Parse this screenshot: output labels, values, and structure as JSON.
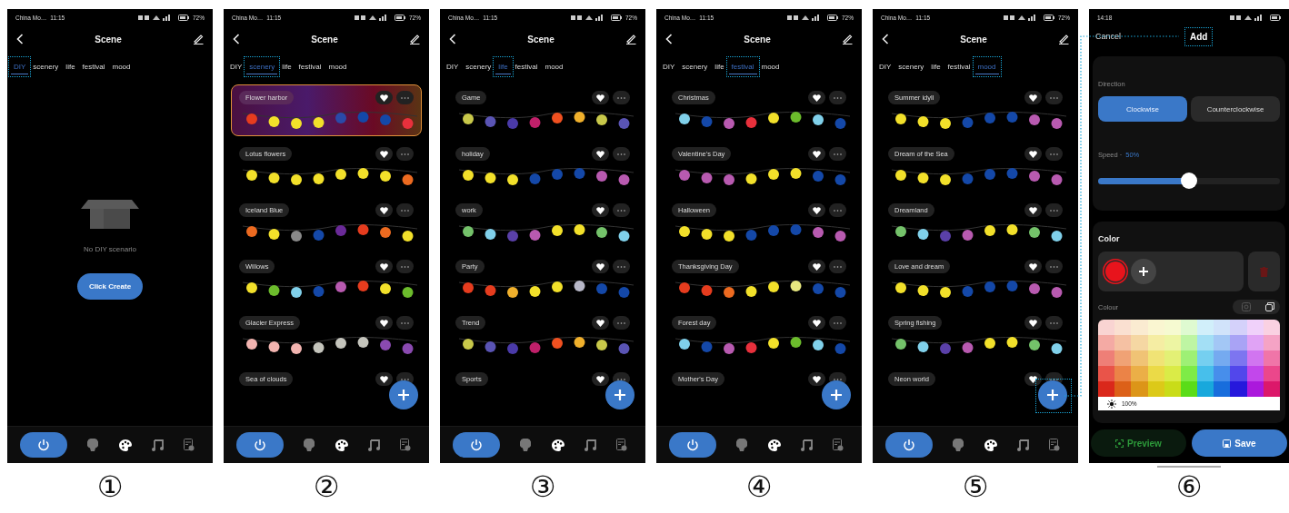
{
  "screens": [
    {
      "kind": "scene_list",
      "caption": "①",
      "status": {
        "carrier": "China Mo…",
        "time": "11:15",
        "battery": "72%"
      },
      "title": "Scene",
      "tabs": [
        {
          "label": "DIY",
          "selected": true
        },
        {
          "label": "scenery",
          "selected": false
        },
        {
          "label": "life",
          "selected": false
        },
        {
          "label": "festival",
          "selected": false
        },
        {
          "label": "mood",
          "selected": false
        }
      ],
      "empty": {
        "message": "No DIY scenario",
        "button": "Click Create"
      },
      "nav": [
        {
          "kind": "power",
          "selected": true
        },
        {
          "kind": "bulb",
          "selected": false
        },
        {
          "kind": "palette",
          "selected": true
        },
        {
          "kind": "music",
          "selected": false
        },
        {
          "kind": "schedule",
          "selected": false
        }
      ]
    },
    {
      "kind": "scene_list",
      "caption": "②",
      "status": {
        "carrier": "China Mo…",
        "time": "11:15",
        "battery": "72%"
      },
      "title": "Scene",
      "tabs": [
        {
          "label": "DIY",
          "selected": false
        },
        {
          "label": "scenery",
          "selected": true
        },
        {
          "label": "life",
          "selected": false
        },
        {
          "label": "festival",
          "selected": false
        },
        {
          "label": "mood",
          "selected": false
        }
      ],
      "scenes": [
        {
          "name": "Flower harbor",
          "selected": true,
          "lights": [
            {
              "color": "#e63c1e"
            },
            {
              "color": "#f2e02a"
            },
            {
              "color": "#f2e02a"
            },
            {
              "color": "#f2e02a"
            },
            {
              "color": "#2a4aa8"
            },
            {
              "color": "#1448a8"
            },
            {
              "color": "#1448a8"
            },
            {
              "color": "#e8303c"
            }
          ]
        },
        {
          "name": "Lotus flowers",
          "selected": false,
          "lights": [
            {
              "color": "#f2e02a"
            },
            {
              "color": "#f2e02a"
            },
            {
              "color": "#f2e02a"
            },
            {
              "color": "#f2e02a"
            },
            {
              "color": "#f2e02a"
            },
            {
              "color": "#f2e02a"
            },
            {
              "color": "#f2e02a"
            },
            {
              "color": "#ec6a20"
            }
          ]
        },
        {
          "name": "Iceland Blue",
          "selected": false,
          "lights": [
            {
              "color": "#ec6a20"
            },
            {
              "color": "#f2e02a"
            },
            {
              "color": "#8a8a8a"
            },
            {
              "color": "#1448a8"
            },
            {
              "color": "#6a2a98"
            },
            {
              "color": "#e63c1e"
            },
            {
              "color": "#ec6a20"
            },
            {
              "color": "#f2e02a"
            }
          ]
        },
        {
          "name": "Willows",
          "selected": false,
          "lights": [
            {
              "color": "#f2e02a"
            },
            {
              "color": "#6cbc2c"
            },
            {
              "color": "#80d0ea"
            },
            {
              "color": "#1448a8"
            },
            {
              "color": "#b85ab0"
            },
            {
              "color": "#e63c1e"
            },
            {
              "color": "#f2e02a"
            },
            {
              "color": "#6cbc2c"
            }
          ]
        },
        {
          "name": "Glacier Express",
          "selected": false,
          "lights": [
            {
              "color": "#f2b4b0"
            },
            {
              "color": "#f2b4b0"
            },
            {
              "color": "#f2b4b0"
            },
            {
              "color": "#c4c4bc"
            },
            {
              "color": "#c4c4bc"
            },
            {
              "color": "#c4c4bc"
            },
            {
              "color": "#8a4ab0"
            },
            {
              "color": "#8a4ab0"
            }
          ]
        },
        {
          "name": "Sea of clouds",
          "selected": false
        }
      ],
      "fab": {
        "highlighted": false
      },
      "nav": [
        {
          "kind": "power",
          "selected": true
        },
        {
          "kind": "bulb",
          "selected": false
        },
        {
          "kind": "palette",
          "selected": true
        },
        {
          "kind": "music",
          "selected": false
        },
        {
          "kind": "schedule",
          "selected": false
        }
      ]
    },
    {
      "kind": "scene_list",
      "caption": "③",
      "status": {
        "carrier": "China Mo…",
        "time": "11:15",
        "battery": "72%"
      },
      "title": "Scene",
      "tabs": [
        {
          "label": "DIY",
          "selected": false
        },
        {
          "label": "scenery",
          "selected": false
        },
        {
          "label": "life",
          "selected": true
        },
        {
          "label": "festival",
          "selected": false
        },
        {
          "label": "mood",
          "selected": false
        }
      ],
      "scenes": [
        {
          "name": "Game",
          "selected": false,
          "lights": [
            {
              "color": "#c8c84a"
            },
            {
              "color": "#5a54b4"
            },
            {
              "color": "#4a3aa8"
            },
            {
              "color": "#c0206a"
            },
            {
              "color": "#f05020"
            },
            {
              "color": "#f0b02c"
            },
            {
              "color": "#c8c84a"
            },
            {
              "color": "#5a54b4"
            }
          ]
        },
        {
          "name": "holiday",
          "selected": false,
          "lights": [
            {
              "color": "#f2e02a"
            },
            {
              "color": "#f2e02a"
            },
            {
              "color": "#f2e02a"
            },
            {
              "color": "#1448a8"
            },
            {
              "color": "#1448a8"
            },
            {
              "color": "#1448a8"
            },
            {
              "color": "#b85ab0"
            },
            {
              "color": "#b85ab0"
            }
          ]
        },
        {
          "name": "work",
          "selected": false,
          "lights": [
            {
              "color": "#74c26a"
            },
            {
              "color": "#80d0ea"
            },
            {
              "color": "#5a40a8"
            },
            {
              "color": "#b85ab0"
            },
            {
              "color": "#f2e02a"
            },
            {
              "color": "#f2e02a"
            },
            {
              "color": "#74c26a"
            },
            {
              "color": "#80d0ea"
            }
          ]
        },
        {
          "name": "Party",
          "selected": false,
          "lights": [
            {
              "color": "#e63c1e"
            },
            {
              "color": "#e63c1e"
            },
            {
              "color": "#f0b02c"
            },
            {
              "color": "#f2e02a"
            },
            {
              "color": "#f2e02a"
            },
            {
              "color": "#b8b8c8"
            },
            {
              "color": "#1448a8"
            },
            {
              "color": "#1448a8"
            }
          ]
        },
        {
          "name": "Trend",
          "selected": false,
          "lights": [
            {
              "color": "#c8c84a"
            },
            {
              "color": "#5a54b4"
            },
            {
              "color": "#4a3aa8"
            },
            {
              "color": "#c0206a"
            },
            {
              "color": "#f05020"
            },
            {
              "color": "#f0b02c"
            },
            {
              "color": "#c8c84a"
            },
            {
              "color": "#5a54b4"
            }
          ]
        },
        {
          "name": "Sports",
          "selected": false
        }
      ],
      "fab": {
        "highlighted": false
      },
      "nav": [
        {
          "kind": "power",
          "selected": true
        },
        {
          "kind": "bulb",
          "selected": false
        },
        {
          "kind": "palette",
          "selected": true
        },
        {
          "kind": "music",
          "selected": false
        },
        {
          "kind": "schedule",
          "selected": false
        }
      ]
    },
    {
      "kind": "scene_list",
      "caption": "④",
      "status": {
        "carrier": "China Mo…",
        "time": "11:15",
        "battery": "72%"
      },
      "title": "Scene",
      "tabs": [
        {
          "label": "DIY",
          "selected": false
        },
        {
          "label": "scenery",
          "selected": false
        },
        {
          "label": "life",
          "selected": false
        },
        {
          "label": "festival",
          "selected": true
        },
        {
          "label": "mood",
          "selected": false
        }
      ],
      "scenes": [
        {
          "name": "Christmas",
          "selected": false,
          "lights": [
            {
              "color": "#80d0ea"
            },
            {
              "color": "#1448a8"
            },
            {
              "color": "#b85ab0"
            },
            {
              "color": "#e8303c"
            },
            {
              "color": "#f2e02a"
            },
            {
              "color": "#6cbc2c"
            },
            {
              "color": "#80d0ea"
            },
            {
              "color": "#1448a8"
            }
          ]
        },
        {
          "name": "Valentine's Day",
          "selected": false,
          "lights": [
            {
              "color": "#b85ab0"
            },
            {
              "color": "#b85ab0"
            },
            {
              "color": "#b85ab0"
            },
            {
              "color": "#f2e02a"
            },
            {
              "color": "#f2e02a"
            },
            {
              "color": "#f2e02a"
            },
            {
              "color": "#1448a8"
            },
            {
              "color": "#1448a8"
            }
          ]
        },
        {
          "name": "Halloween",
          "selected": false,
          "lights": [
            {
              "color": "#f2e02a"
            },
            {
              "color": "#f2e02a"
            },
            {
              "color": "#f2e02a"
            },
            {
              "color": "#1448a8"
            },
            {
              "color": "#1448a8"
            },
            {
              "color": "#1448a8"
            },
            {
              "color": "#b85ab0"
            },
            {
              "color": "#b85ab0"
            }
          ]
        },
        {
          "name": "Thanksgiving Day",
          "selected": false,
          "lights": [
            {
              "color": "#e63c1e"
            },
            {
              "color": "#e63c1e"
            },
            {
              "color": "#ec6a20"
            },
            {
              "color": "#f2e02a"
            },
            {
              "color": "#f2e02a"
            },
            {
              "color": "#e8e880"
            },
            {
              "color": "#1448a8"
            },
            {
              "color": "#1448a8"
            }
          ]
        },
        {
          "name": "Forest day",
          "selected": false,
          "lights": [
            {
              "color": "#80d0ea"
            },
            {
              "color": "#1448a8"
            },
            {
              "color": "#b85ab0"
            },
            {
              "color": "#e8303c"
            },
            {
              "color": "#f2e02a"
            },
            {
              "color": "#6cbc2c"
            },
            {
              "color": "#80d0ea"
            },
            {
              "color": "#1448a8"
            }
          ]
        },
        {
          "name": "Mother's Day",
          "selected": false
        }
      ],
      "fab": {
        "highlighted": false
      },
      "nav": [
        {
          "kind": "power",
          "selected": true
        },
        {
          "kind": "bulb",
          "selected": false
        },
        {
          "kind": "palette",
          "selected": true
        },
        {
          "kind": "music",
          "selected": false
        },
        {
          "kind": "schedule",
          "selected": false
        }
      ]
    },
    {
      "kind": "scene_list",
      "caption": "⑤",
      "status": {
        "carrier": "China Mo…",
        "time": "11:15",
        "battery": "72%"
      },
      "title": "Scene",
      "tabs": [
        {
          "label": "DIY",
          "selected": false
        },
        {
          "label": "scenery",
          "selected": false
        },
        {
          "label": "life",
          "selected": false
        },
        {
          "label": "festival",
          "selected": false
        },
        {
          "label": "mood",
          "selected": true
        }
      ],
      "scenes": [
        {
          "name": "Summer idyll",
          "selected": false,
          "lights": [
            {
              "color": "#f2e02a"
            },
            {
              "color": "#f2e02a"
            },
            {
              "color": "#f2e02a"
            },
            {
              "color": "#1448a8"
            },
            {
              "color": "#1448a8"
            },
            {
              "color": "#1448a8"
            },
            {
              "color": "#b85ab0"
            },
            {
              "color": "#b85ab0"
            }
          ]
        },
        {
          "name": "Dream of the Sea",
          "selected": false,
          "lights": [
            {
              "color": "#f2e02a"
            },
            {
              "color": "#f2e02a"
            },
            {
              "color": "#f2e02a"
            },
            {
              "color": "#1448a8"
            },
            {
              "color": "#1448a8"
            },
            {
              "color": "#1448a8"
            },
            {
              "color": "#b85ab0"
            },
            {
              "color": "#b85ab0"
            }
          ]
        },
        {
          "name": "Dreamland",
          "selected": false,
          "lights": [
            {
              "color": "#74c26a"
            },
            {
              "color": "#80d0ea"
            },
            {
              "color": "#5a40a8"
            },
            {
              "color": "#b85ab0"
            },
            {
              "color": "#f2e02a"
            },
            {
              "color": "#f2e02a"
            },
            {
              "color": "#74c26a"
            },
            {
              "color": "#80d0ea"
            }
          ]
        },
        {
          "name": "Love and dream",
          "selected": false,
          "lights": [
            {
              "color": "#f2e02a"
            },
            {
              "color": "#f2e02a"
            },
            {
              "color": "#f2e02a"
            },
            {
              "color": "#1448a8"
            },
            {
              "color": "#1448a8"
            },
            {
              "color": "#1448a8"
            },
            {
              "color": "#b85ab0"
            },
            {
              "color": "#b85ab0"
            }
          ]
        },
        {
          "name": "Spring fishing",
          "selected": false,
          "lights": [
            {
              "color": "#74c26a"
            },
            {
              "color": "#80d0ea"
            },
            {
              "color": "#5a40a8"
            },
            {
              "color": "#b85ab0"
            },
            {
              "color": "#f2e02a"
            },
            {
              "color": "#f2e02a"
            },
            {
              "color": "#74c26a"
            },
            {
              "color": "#80d0ea"
            }
          ]
        },
        {
          "name": "Neon world",
          "selected": false
        }
      ],
      "fab": {
        "highlighted": true
      },
      "nav": [
        {
          "kind": "power",
          "selected": true
        },
        {
          "kind": "bulb",
          "selected": false
        },
        {
          "kind": "palette",
          "selected": true
        },
        {
          "kind": "music",
          "selected": false
        },
        {
          "kind": "schedule",
          "selected": false
        }
      ]
    },
    {
      "kind": "editor",
      "caption": "⑥",
      "status": {
        "time": "14:18"
      },
      "cancel": "Cancel",
      "add": {
        "label": "Add",
        "highlighted": true
      },
      "direction": {
        "label": "Direction",
        "options": [
          {
            "label": "Clockwise",
            "selected": true
          },
          {
            "label": "Counterclockwise",
            "selected": false
          }
        ]
      },
      "speed": {
        "label": "Speed ·",
        "value": "50%",
        "level": 0.5
      },
      "color": {
        "title": "Color",
        "chips": [
          {
            "color": "#e8141c",
            "selected": true
          }
        ],
        "palette_label": "Colour",
        "brightness": "100%"
      },
      "buttons": {
        "preview": "Preview",
        "save": "Save"
      }
    }
  ]
}
